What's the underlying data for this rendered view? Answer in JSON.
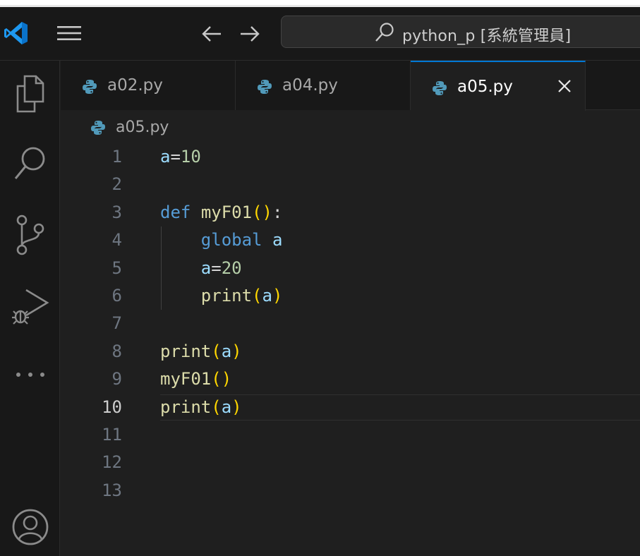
{
  "window": {
    "command_center": "python_p [系統管理員]"
  },
  "icons": {
    "logo": "vscode-logo",
    "menu": "hamburger-menu-icon",
    "back": "arrow-left-icon",
    "forward": "arrow-right-icon",
    "search": "search-icon",
    "explorer": "files-icon",
    "source_control": "source-control-icon",
    "run_debug": "run-debug-icon",
    "more": "ellipsis-icon",
    "account": "account-icon",
    "python": "python-icon",
    "close": "close-icon"
  },
  "colors": {
    "accent": "#0078d4",
    "keyword": "#569cd6",
    "function": "#dcdcaa",
    "variable": "#9cdcfe",
    "number": "#b5cea8",
    "bracket": "#ffd700"
  },
  "tabs": [
    {
      "label": "a02.py",
      "active": false
    },
    {
      "label": "a04.py",
      "active": false
    },
    {
      "label": "a05.py",
      "active": true
    }
  ],
  "breadcrumb": {
    "file": "a05.py"
  },
  "editor": {
    "current_line": 10,
    "lines": [
      {
        "num": "1",
        "tokens": [
          {
            "t": "a",
            "c": "v"
          },
          {
            "t": "=",
            "c": "o"
          },
          {
            "t": "10",
            "c": "n"
          }
        ]
      },
      {
        "num": "2",
        "tokens": []
      },
      {
        "num": "3",
        "tokens": [
          {
            "t": "def",
            "c": "k"
          },
          {
            "t": " ",
            "c": "o"
          },
          {
            "t": "myF01",
            "c": "f"
          },
          {
            "t": "()",
            "c": "p"
          },
          {
            "t": ":",
            "c": "o"
          }
        ]
      },
      {
        "num": "4",
        "tokens": [
          {
            "t": "    ",
            "c": "o"
          },
          {
            "t": "global",
            "c": "k"
          },
          {
            "t": " ",
            "c": "o"
          },
          {
            "t": "a",
            "c": "v"
          }
        ]
      },
      {
        "num": "5",
        "tokens": [
          {
            "t": "    ",
            "c": "o"
          },
          {
            "t": "a",
            "c": "v"
          },
          {
            "t": "=",
            "c": "o"
          },
          {
            "t": "20",
            "c": "n"
          }
        ]
      },
      {
        "num": "6",
        "tokens": [
          {
            "t": "    ",
            "c": "o"
          },
          {
            "t": "print",
            "c": "f"
          },
          {
            "t": "(",
            "c": "p"
          },
          {
            "t": "a",
            "c": "v"
          },
          {
            "t": ")",
            "c": "p"
          }
        ]
      },
      {
        "num": "7",
        "tokens": []
      },
      {
        "num": "8",
        "tokens": [
          {
            "t": "print",
            "c": "f"
          },
          {
            "t": "(",
            "c": "p"
          },
          {
            "t": "a",
            "c": "v"
          },
          {
            "t": ")",
            "c": "p"
          }
        ]
      },
      {
        "num": "9",
        "tokens": [
          {
            "t": "myF01",
            "c": "f"
          },
          {
            "t": "()",
            "c": "p"
          }
        ]
      },
      {
        "num": "10",
        "tokens": [
          {
            "t": "print",
            "c": "f"
          },
          {
            "t": "(",
            "c": "p"
          },
          {
            "t": "a",
            "c": "v"
          },
          {
            "t": ")",
            "c": "p"
          }
        ]
      },
      {
        "num": "11",
        "tokens": []
      },
      {
        "num": "12",
        "tokens": []
      },
      {
        "num": "13",
        "tokens": []
      }
    ]
  }
}
